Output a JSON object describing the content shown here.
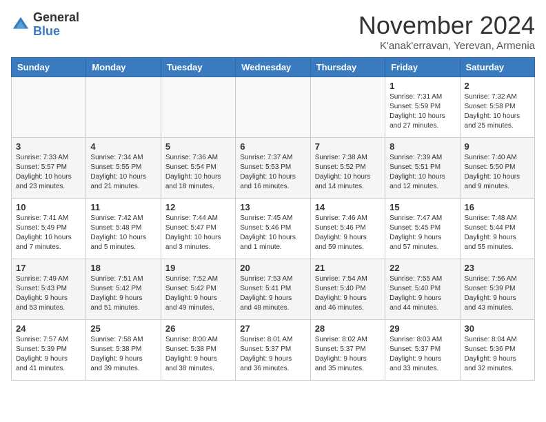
{
  "header": {
    "logo_general": "General",
    "logo_blue": "Blue",
    "month_title": "November 2024",
    "subtitle": "K'anak'erravan, Yerevan, Armenia"
  },
  "weekdays": [
    "Sunday",
    "Monday",
    "Tuesday",
    "Wednesday",
    "Thursday",
    "Friday",
    "Saturday"
  ],
  "rows": [
    {
      "cells": [
        {
          "empty": true
        },
        {
          "empty": true
        },
        {
          "empty": true
        },
        {
          "empty": true
        },
        {
          "empty": true
        },
        {
          "day": 1,
          "info": "Sunrise: 7:31 AM\nSunset: 5:59 PM\nDaylight: 10 hours\nand 27 minutes."
        },
        {
          "day": 2,
          "info": "Sunrise: 7:32 AM\nSunset: 5:58 PM\nDaylight: 10 hours\nand 25 minutes."
        }
      ]
    },
    {
      "cells": [
        {
          "day": 3,
          "info": "Sunrise: 7:33 AM\nSunset: 5:57 PM\nDaylight: 10 hours\nand 23 minutes."
        },
        {
          "day": 4,
          "info": "Sunrise: 7:34 AM\nSunset: 5:55 PM\nDaylight: 10 hours\nand 21 minutes."
        },
        {
          "day": 5,
          "info": "Sunrise: 7:36 AM\nSunset: 5:54 PM\nDaylight: 10 hours\nand 18 minutes."
        },
        {
          "day": 6,
          "info": "Sunrise: 7:37 AM\nSunset: 5:53 PM\nDaylight: 10 hours\nand 16 minutes."
        },
        {
          "day": 7,
          "info": "Sunrise: 7:38 AM\nSunset: 5:52 PM\nDaylight: 10 hours\nand 14 minutes."
        },
        {
          "day": 8,
          "info": "Sunrise: 7:39 AM\nSunset: 5:51 PM\nDaylight: 10 hours\nand 12 minutes."
        },
        {
          "day": 9,
          "info": "Sunrise: 7:40 AM\nSunset: 5:50 PM\nDaylight: 10 hours\nand 9 minutes."
        }
      ]
    },
    {
      "cells": [
        {
          "day": 10,
          "info": "Sunrise: 7:41 AM\nSunset: 5:49 PM\nDaylight: 10 hours\nand 7 minutes."
        },
        {
          "day": 11,
          "info": "Sunrise: 7:42 AM\nSunset: 5:48 PM\nDaylight: 10 hours\nand 5 minutes."
        },
        {
          "day": 12,
          "info": "Sunrise: 7:44 AM\nSunset: 5:47 PM\nDaylight: 10 hours\nand 3 minutes."
        },
        {
          "day": 13,
          "info": "Sunrise: 7:45 AM\nSunset: 5:46 PM\nDaylight: 10 hours\nand 1 minute."
        },
        {
          "day": 14,
          "info": "Sunrise: 7:46 AM\nSunset: 5:46 PM\nDaylight: 9 hours\nand 59 minutes."
        },
        {
          "day": 15,
          "info": "Sunrise: 7:47 AM\nSunset: 5:45 PM\nDaylight: 9 hours\nand 57 minutes."
        },
        {
          "day": 16,
          "info": "Sunrise: 7:48 AM\nSunset: 5:44 PM\nDaylight: 9 hours\nand 55 minutes."
        }
      ]
    },
    {
      "cells": [
        {
          "day": 17,
          "info": "Sunrise: 7:49 AM\nSunset: 5:43 PM\nDaylight: 9 hours\nand 53 minutes."
        },
        {
          "day": 18,
          "info": "Sunrise: 7:51 AM\nSunset: 5:42 PM\nDaylight: 9 hours\nand 51 minutes."
        },
        {
          "day": 19,
          "info": "Sunrise: 7:52 AM\nSunset: 5:42 PM\nDaylight: 9 hours\nand 49 minutes."
        },
        {
          "day": 20,
          "info": "Sunrise: 7:53 AM\nSunset: 5:41 PM\nDaylight: 9 hours\nand 48 minutes."
        },
        {
          "day": 21,
          "info": "Sunrise: 7:54 AM\nSunset: 5:40 PM\nDaylight: 9 hours\nand 46 minutes."
        },
        {
          "day": 22,
          "info": "Sunrise: 7:55 AM\nSunset: 5:40 PM\nDaylight: 9 hours\nand 44 minutes."
        },
        {
          "day": 23,
          "info": "Sunrise: 7:56 AM\nSunset: 5:39 PM\nDaylight: 9 hours\nand 43 minutes."
        }
      ]
    },
    {
      "cells": [
        {
          "day": 24,
          "info": "Sunrise: 7:57 AM\nSunset: 5:39 PM\nDaylight: 9 hours\nand 41 minutes."
        },
        {
          "day": 25,
          "info": "Sunrise: 7:58 AM\nSunset: 5:38 PM\nDaylight: 9 hours\nand 39 minutes."
        },
        {
          "day": 26,
          "info": "Sunrise: 8:00 AM\nSunset: 5:38 PM\nDaylight: 9 hours\nand 38 minutes."
        },
        {
          "day": 27,
          "info": "Sunrise: 8:01 AM\nSunset: 5:37 PM\nDaylight: 9 hours\nand 36 minutes."
        },
        {
          "day": 28,
          "info": "Sunrise: 8:02 AM\nSunset: 5:37 PM\nDaylight: 9 hours\nand 35 minutes."
        },
        {
          "day": 29,
          "info": "Sunrise: 8:03 AM\nSunset: 5:37 PM\nDaylight: 9 hours\nand 33 minutes."
        },
        {
          "day": 30,
          "info": "Sunrise: 8:04 AM\nSunset: 5:36 PM\nDaylight: 9 hours\nand 32 minutes."
        }
      ]
    }
  ]
}
